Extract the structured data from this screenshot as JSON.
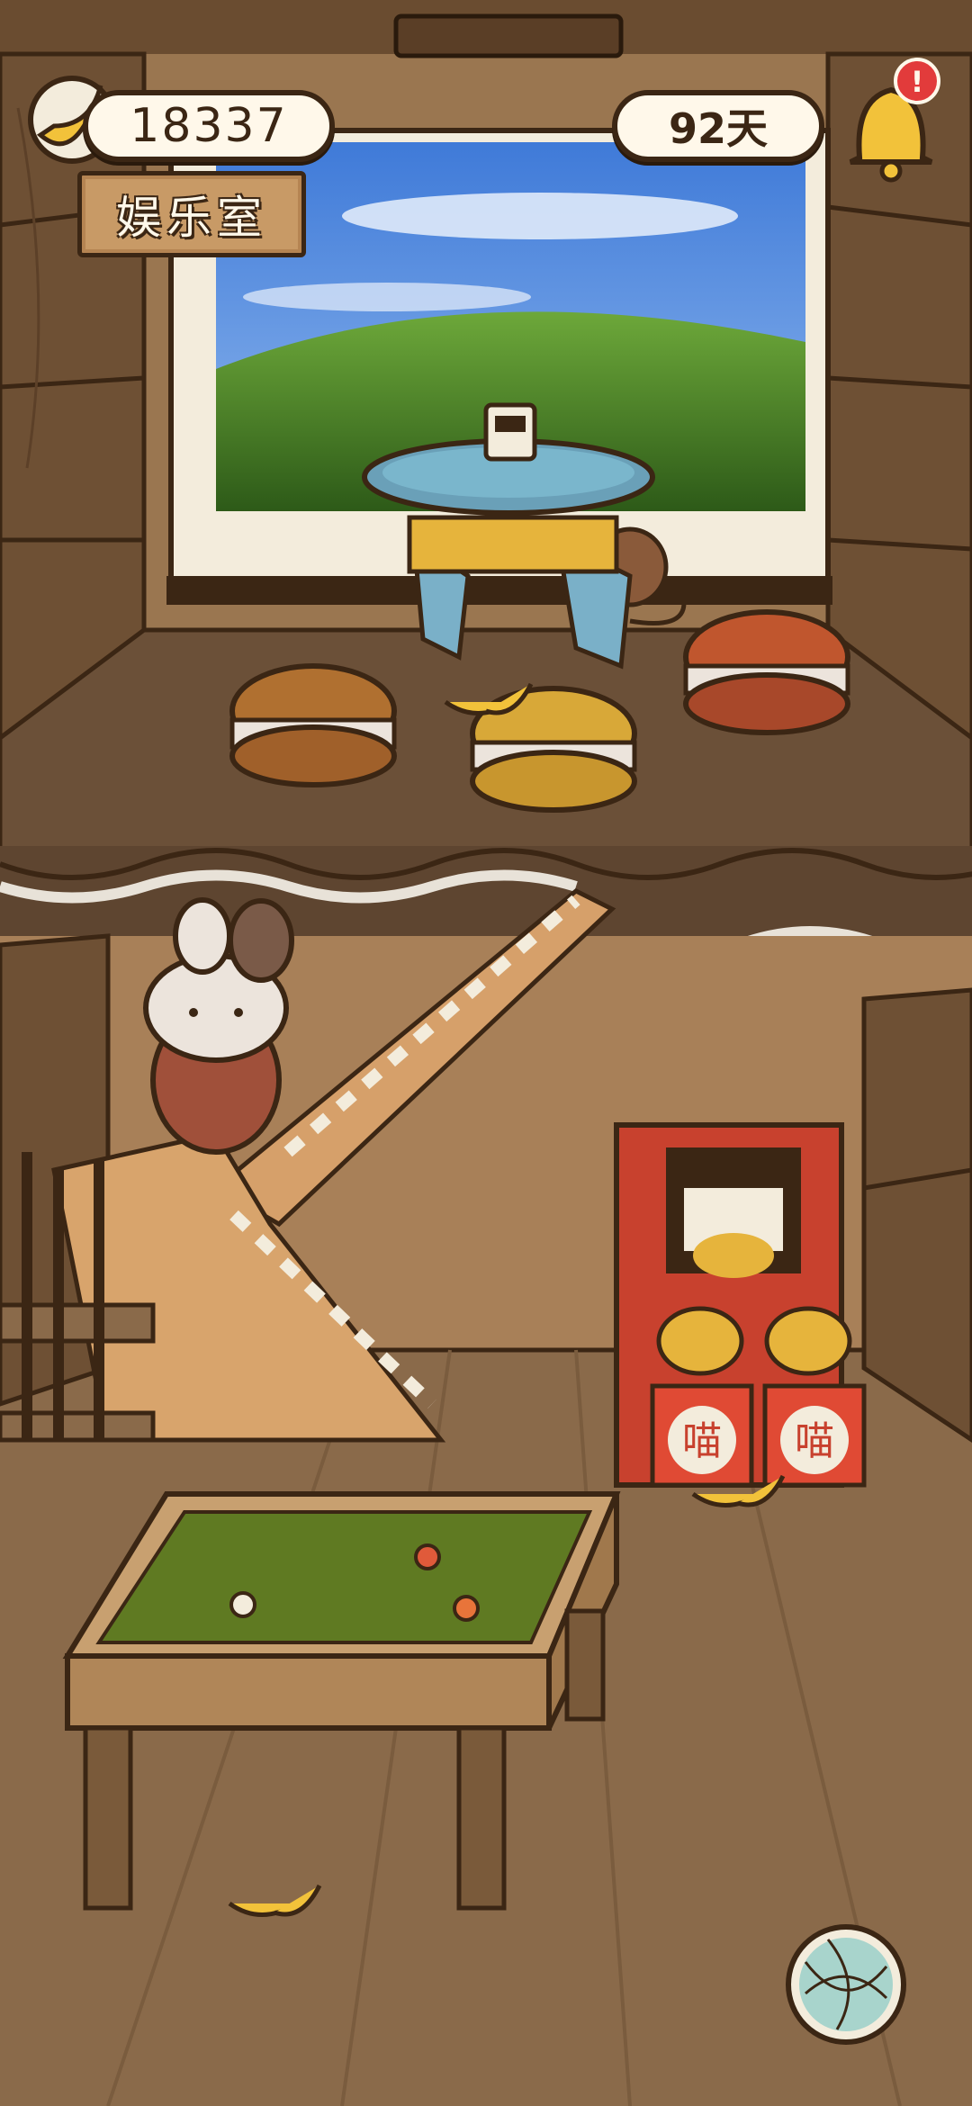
{
  "hud": {
    "banana_count": "18337",
    "days": "92天",
    "room_name": "娱乐室",
    "notification_badge": "!"
  },
  "arcade": {
    "left_label": "喵",
    "right_label": "喵"
  },
  "colors": {
    "wall": "#7a5a3a",
    "floor": "#8a6a4a",
    "accent_badge": "#e23b3b",
    "banana": "#f2c23a",
    "table_felt": "#5f7a22",
    "arcade_red": "#c8412e"
  },
  "icons": {
    "banana_counter": "banana-icon",
    "notifications": "bell-icon",
    "bottom_right_button": "yarn-ball-icon"
  }
}
